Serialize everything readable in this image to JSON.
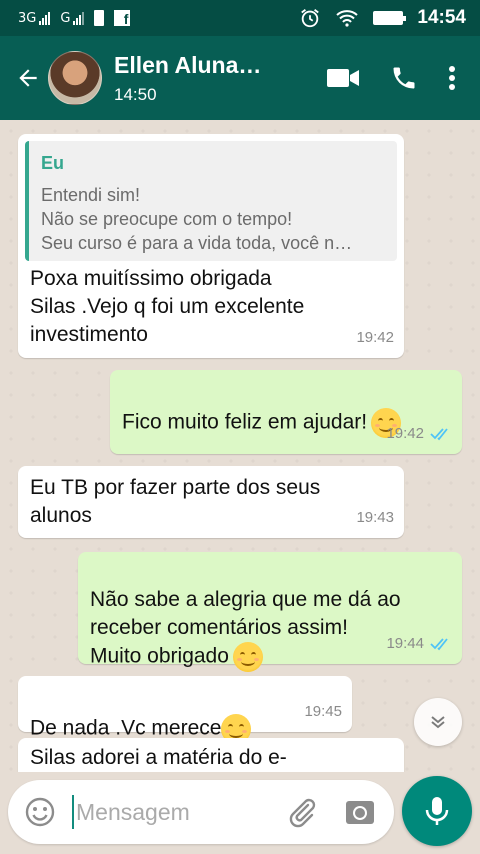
{
  "status_bar": {
    "network_1": "3G",
    "network_2": "G",
    "time": "14:54"
  },
  "header": {
    "contact_name": "Ellen Aluna…",
    "contact_status": "14:50"
  },
  "messages": [
    {
      "direction": "incoming",
      "quote": {
        "author": "Eu",
        "lines": [
          "Entendi sim!",
          "Não se preocupe com o tempo!",
          "Seu curso é para a vida toda, você n…"
        ]
      },
      "text": "Poxa muitíssimo obrigada\nSilas .Vejo q foi um excelente\ninvestimento",
      "time": "19:42"
    },
    {
      "direction": "outgoing",
      "text": "Fico muito feliz em ajudar!",
      "emoji": "smiling-face",
      "time": "19:42",
      "status": "read"
    },
    {
      "direction": "incoming",
      "text": "Eu TB por fazer parte dos seus\nalunos",
      "time": "19:43"
    },
    {
      "direction": "outgoing",
      "text": "Não sabe a alegria que me dá ao\nreceber comentários assim!\nMuito obrigado",
      "emoji": "smiling-face",
      "time": "19:44",
      "status": "read"
    },
    {
      "direction": "incoming",
      "text": "De nada .Vc merece",
      "emoji": "smiling-face",
      "time": "19:45"
    },
    {
      "direction": "incoming",
      "text": "Silas adorei a matéria do e-"
    }
  ],
  "composer": {
    "placeholder": "Mensagem"
  },
  "colors": {
    "header": "#075e54",
    "status_bar": "#054d44",
    "outgoing_bubble": "#dcf8c6",
    "incoming_bubble": "#ffffff",
    "accent": "#00897b",
    "read_ticks": "#4fc3f7"
  },
  "icons": [
    "back-arrow-icon",
    "video-call-icon",
    "phone-icon",
    "more-options-icon",
    "emoji-icon",
    "attach-icon",
    "camera-icon",
    "mic-icon",
    "chevron-down-icon",
    "double-check-icon"
  ]
}
